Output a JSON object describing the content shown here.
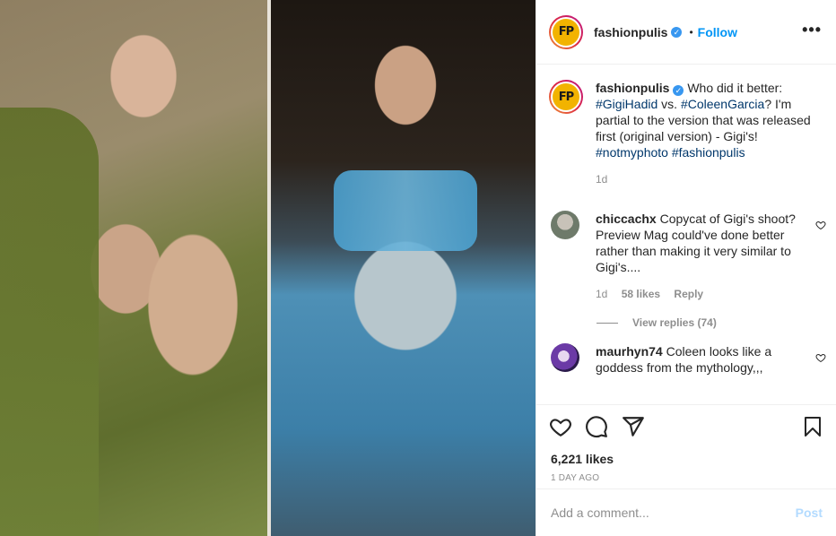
{
  "post": {
    "username": "fashionpulis",
    "follow_label": "Follow",
    "dot": "•",
    "more_label": "•••",
    "logo_text": "FP",
    "verified_mark": "✓"
  },
  "caption": {
    "username": "fashionpulis",
    "text_1": "Who did it better: ",
    "tag_1": "#GigiHadid",
    "text_2": " vs. ",
    "tag_2": "#ColeenGarcia",
    "text_3": "? I'm partial to the version that was released first (original version) - Gigi's! ",
    "tag_3": "#notmyphoto",
    "text_4": " ",
    "tag_4": "#fashionpulis",
    "age": "1d"
  },
  "comments": [
    {
      "username": "chiccachx",
      "text": "Copycat of Gigi's shoot? Preview Mag could've done better rather than making it very similar to Gigi's....",
      "age": "1d",
      "likes": "58 likes",
      "reply_label": "Reply"
    },
    {
      "username": "maurhyn74",
      "text": "Coleen looks like a goddess from the mythology,,,"
    }
  ],
  "view_replies": "View replies (74)",
  "likes_count": "6,221 likes",
  "time_ago": "1 DAY AGO",
  "add_comment": {
    "placeholder": "Add a comment...",
    "post_label": "Post"
  },
  "colors": {
    "link_blue": "#0095f6",
    "hashtag": "#00376b",
    "post_disabled": "#b3dbff",
    "logo_yellow": "#f2b300"
  }
}
